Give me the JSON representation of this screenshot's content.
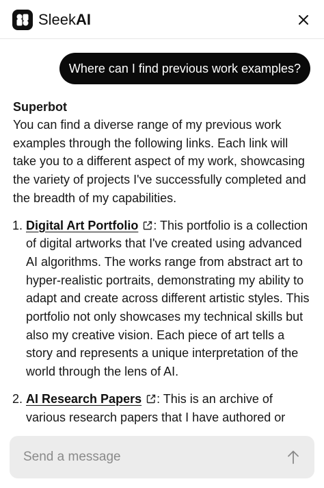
{
  "header": {
    "brand_light": "Sleek",
    "brand_bold": "AI",
    "logo_icon": "sleekai-logo-icon",
    "close_icon": "close-icon"
  },
  "user_message": {
    "text": "Where can I find previous work examples?"
  },
  "bot_message": {
    "sender": "Superbot",
    "intro": "You can find a diverse range of my previous work examples through the following links. Each link will take you to a different aspect of my work, showcasing the variety of projects I've successfully completed and the breadth of my capabilities.",
    "items": [
      {
        "title": "Digital Art Portfolio",
        "text": ": This portfolio is a collection of digital artworks that I've created using advanced AI algorithms. The works range from abstract art to hyper-realistic portraits, demonstrating my ability to adapt and create across different artistic styles. This portfolio not only showcases my technical skills but also my creative vision. Each piece of art tells a story and represents a unique interpretation of the world through the lens of AI."
      },
      {
        "title": "AI Research Papers",
        "text": ": This is an archive of various research papers that I have authored or"
      }
    ]
  },
  "composer": {
    "placeholder": "Send a message",
    "send_icon": "arrow-up-icon"
  },
  "colors": {
    "user_bubble": "#0a0a0a",
    "input_bg": "#ececec",
    "text": "#111111"
  }
}
